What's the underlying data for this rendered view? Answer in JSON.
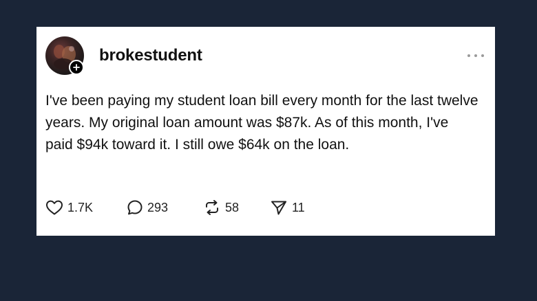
{
  "post": {
    "username": "brokestudent",
    "text": "I've been paying my student loan bill every month for the last twelve years. My original loan amount was $87k. As of this month, I've paid $94k toward it. I still owe $64k on the loan.",
    "actions": {
      "likes": "1.7K",
      "replies": "293",
      "reposts": "58",
      "shares": "11"
    }
  },
  "icons": {
    "follow": "plus-icon",
    "more": "more-horizontal-icon",
    "like": "heart-icon",
    "reply": "comment-bubble-icon",
    "repost": "repost-icon",
    "share": "send-icon"
  },
  "colors": {
    "background": "#1a2537",
    "card": "#ffffff",
    "text": "#111111",
    "muted": "#9a9a9a"
  }
}
